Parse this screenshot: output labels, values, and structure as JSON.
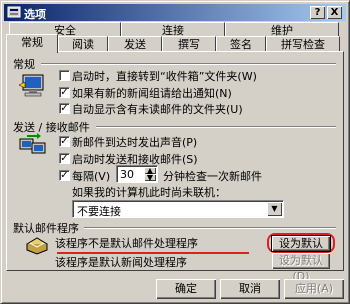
{
  "window": {
    "title": "选项",
    "help_glyph": "?",
    "close_glyph": "X"
  },
  "tabs_back": [
    "安全",
    "连接",
    "维护"
  ],
  "tabs_front": [
    "常规",
    "阅读",
    "发送",
    "撰写",
    "签名",
    "拼写检查"
  ],
  "general": {
    "header": "常规",
    "items": [
      {
        "label": "启动时，直接转到“收件箱”文件夹(W)",
        "checked": false
      },
      {
        "label": "如果有新的新闻组请给出通知(N)",
        "checked": true
      },
      {
        "label": "自动显示含有未读邮件的文件夹(U)",
        "checked": true
      }
    ]
  },
  "send_receive": {
    "header": "发送 / 接收邮件",
    "items": [
      {
        "label": "新邮件到达时发出声音(P)",
        "checked": true
      },
      {
        "label": "启动时发送和接收邮件(S)",
        "checked": true
      }
    ],
    "every": {
      "label": "每隔(V)",
      "checked": true,
      "value": "30",
      "suffix": "分钟检查一次新邮件"
    },
    "offline_label": "如果我的计算机此时尚未联机：",
    "offline_value": "不要连接",
    "check_glyph": "✓",
    "up_glyph": "▲",
    "down_glyph": "▼"
  },
  "default_programs": {
    "header": "默认邮件程序",
    "mail_text": "该程序不是默认邮件处理程序",
    "news_text": "该程序是默认新闻处理程序",
    "set_default_mail": "设为默认(A)",
    "set_default_news": "设为默认(D)",
    "highlight_color": "#e02020"
  },
  "footer": {
    "ok": "确定",
    "cancel": "取消",
    "apply": "应用(A)"
  }
}
